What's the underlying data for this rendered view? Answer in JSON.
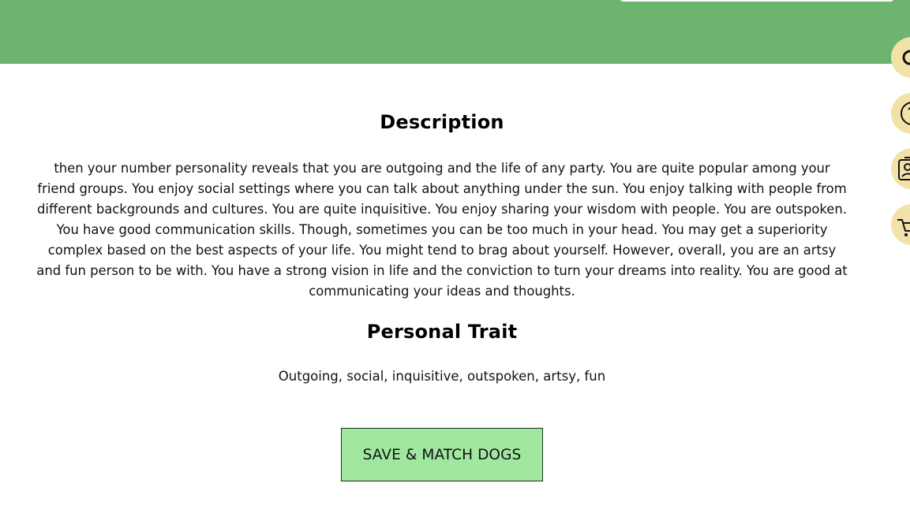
{
  "header": {
    "brand_color": "#6db56f"
  },
  "content": {
    "description_title": "Description",
    "description_text": "then your number personality reveals that you are outgoing and the life of any party. You are quite popular among your friend groups. You enjoy social settings where you can talk about anything under the sun. You enjoy talking with people from different backgrounds and cultures. You are quite inquisitive. You enjoy sharing your wisdom with people. You are outspoken. You have good communication skills. Though, sometimes you can be too much in your head. You may get a superiority complex based on the best aspects of your life. You might tend to brag about yourself. However, overall, you are an artsy and fun person to be with. You have a strong vision in life and the conviction to turn your dreams into reality. You are good at communicating your ideas and thoughts.",
    "trait_title": "Personal Trait",
    "trait_text": "Outgoing, social, inquisitive, outspoken, artsy, fun"
  },
  "actions": {
    "save_match_label": "SAVE & MATCH DOGS",
    "button_color": "#a0e89f"
  },
  "side_rail": {
    "buttons": [
      {
        "icon": "search-icon"
      },
      {
        "icon": "help-icon"
      },
      {
        "icon": "id-card-icon"
      },
      {
        "icon": "cart-icon"
      }
    ],
    "button_color": "#f3e2a8"
  }
}
